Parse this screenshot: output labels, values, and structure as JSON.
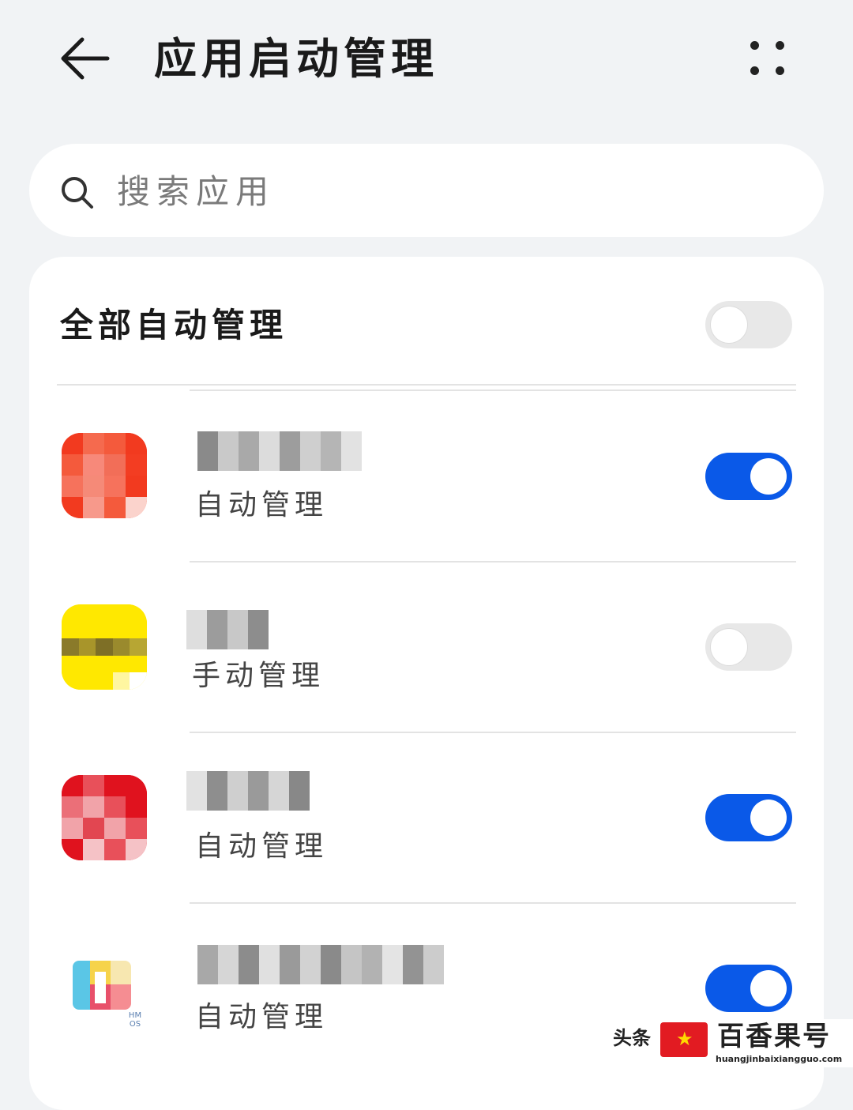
{
  "header": {
    "title": "应用启动管理",
    "back_icon": "arrow-left-icon",
    "more_icon": "more-grid-icon"
  },
  "search": {
    "placeholder": "搜索应用",
    "icon": "search-icon"
  },
  "master": {
    "label": "全部自动管理",
    "enabled": false
  },
  "apps": [
    {
      "status": "自动管理",
      "enabled": true
    },
    {
      "status": "手动管理",
      "enabled": false
    },
    {
      "status": "自动管理",
      "enabled": true
    },
    {
      "status": "自动管理",
      "enabled": true,
      "icon_caption": "HM OS"
    }
  ],
  "watermark": {
    "platform": "头条",
    "brand": "百香果号",
    "url": "huangjinbaixiangguo.com"
  },
  "colors": {
    "accent": "#0a59e8",
    "toggle_off": "#e8e8e8",
    "page_bg": "#f1f3f5",
    "card_bg": "#ffffff"
  }
}
